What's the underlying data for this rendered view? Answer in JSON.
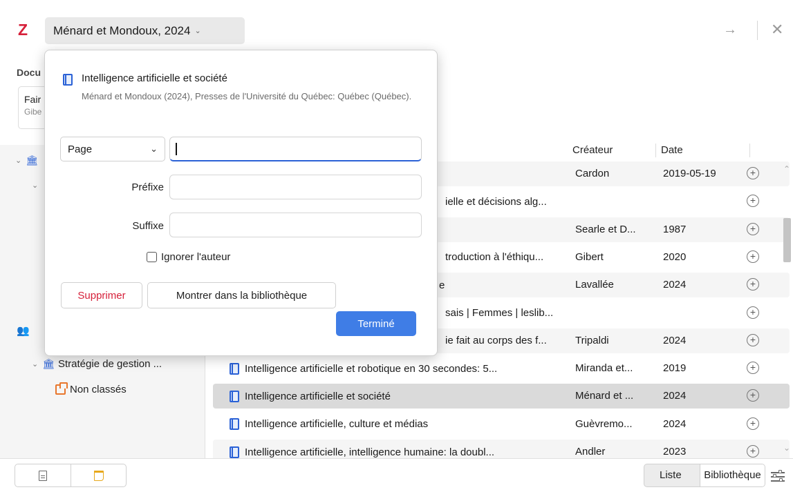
{
  "app": {
    "logo": "Z",
    "citation_selector": "Ménard et Mondoux, 2024",
    "icons": {
      "forward": "arrow-right-icon",
      "close": "close-icon"
    }
  },
  "background": {
    "documents_label": "Docu",
    "doc_card_title": "Fair",
    "doc_card_sub": "Gibe"
  },
  "sidebar": {
    "items": [
      {
        "label": "Stratégie de gestion ...",
        "icon": "library-icon"
      },
      {
        "label": "Non classés",
        "icon": "unfiled-icon"
      }
    ]
  },
  "table": {
    "columns": {
      "creator": "Créateur",
      "date": "Date"
    },
    "rows": [
      {
        "title": "",
        "creator": "Cardon",
        "date": "2019-05-19",
        "partial": ""
      },
      {
        "title": "",
        "creator": "",
        "date": "",
        "partial": "ielle et décisions alg..."
      },
      {
        "title": "",
        "creator": "Searle et D...",
        "date": "1987",
        "partial": ""
      },
      {
        "title": "",
        "creator": "Gibert",
        "date": "2020",
        "partial": "troduction à l'éthiqu..."
      },
      {
        "title": "",
        "creator": "Lavallée",
        "date": "2024",
        "partial": "e"
      },
      {
        "title": "",
        "creator": "",
        "date": "",
        "partial": "sais | Femmes | leslib..."
      },
      {
        "title": "",
        "creator": "Tripaldi",
        "date": "2024",
        "partial": "ie fait au corps des f..."
      },
      {
        "title": "Intelligence artificielle et robotique en 30 secondes: 5...",
        "creator": "Miranda et...",
        "date": "2019",
        "partial": ""
      },
      {
        "title": "Intelligence artificielle et société",
        "creator": "Ménard et ...",
        "date": "2024",
        "partial": ""
      },
      {
        "title": "Intelligence artificielle, culture et médias",
        "creator": "Guèvremo...",
        "date": "2024",
        "partial": ""
      },
      {
        "title": "Intelligence artificielle, intelligence humaine: la doubl...",
        "creator": "Andler",
        "date": "2023",
        "partial": ""
      }
    ],
    "selected_row_index": 8
  },
  "popup": {
    "item_title": "Intelligence artificielle et société",
    "item_subtitle": "Ménard et Mondoux (2024), Presses de l'Université du Québec: Québec (Québec).",
    "locator_select": "Page",
    "locator_value": "",
    "prefix_label": "Préfixe",
    "prefix_value": "",
    "suffix_label": "Suffixe",
    "suffix_value": "",
    "suppress_author_label": "Ignorer l'auteur",
    "suppress_author_checked": false,
    "remove_button": "Supprimer",
    "show_in_library_button": "Montrer dans la bibliothèque",
    "done_button": "Terminé"
  },
  "bottombar": {
    "toggle_list": "Liste",
    "toggle_library": "Bibliothèque",
    "icons": {
      "document": "document-icon",
      "note": "note-icon",
      "settings": "settings-sliders-icon"
    }
  },
  "colors": {
    "accent": "#3f7de6",
    "brand_red": "#d6203a",
    "selected_row": "#dadada"
  }
}
